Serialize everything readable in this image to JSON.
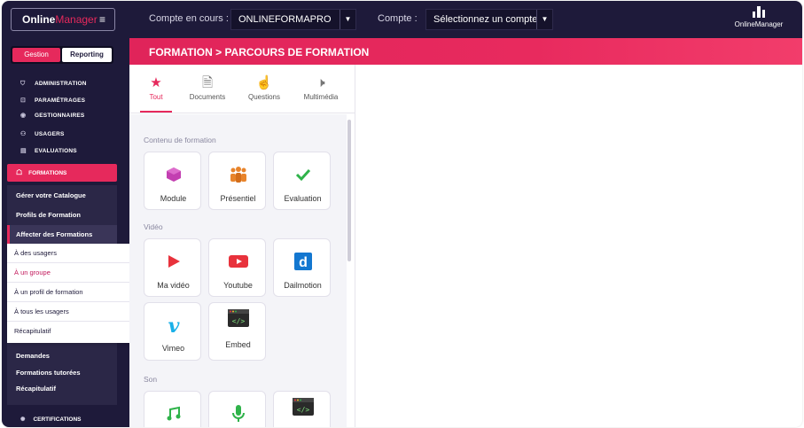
{
  "topbar": {
    "brand_main": "Online",
    "brand_accent": "Manager",
    "menu_glyph": "≡",
    "compte_en_cours_label": "Compte en cours :",
    "compte_en_cours_value": "ONLINEFORMAPRO",
    "compte_label": "Compte :",
    "compte_placeholder": "Sélectionnez un compte",
    "logo_text": "OnlineManager"
  },
  "sidebar": {
    "tab_gestion": "Gestion",
    "tab_reporting": "Reporting",
    "items": [
      {
        "icon": "shield-icon",
        "label": "ADMINISTRATION"
      },
      {
        "icon": "settings-icon",
        "label": "PARAMÉTRAGES"
      },
      {
        "icon": "user-circle-icon",
        "label": "GESTIONNAIRES"
      },
      {
        "icon": "users-icon",
        "label": "USAGERS"
      },
      {
        "icon": "clipboard-icon",
        "label": "EVALUATIONS"
      }
    ],
    "formations_label": "FORMATIONS",
    "sub_items": [
      "Gérer votre Catalogue",
      "Profils de Formation",
      "Affecter des Formations",
      "Demandes",
      "Formations tutorées",
      "Récapitulatif"
    ],
    "dropdown_items": [
      "À des usagers",
      "À un groupe",
      "À un profil de formation",
      "À tous les usagers",
      "Récapitulatif"
    ],
    "certifications_label": "CERTIFICATIONS"
  },
  "header": {
    "breadcrumb": "FORMATION > PARCOURS DE FORMATION"
  },
  "library": {
    "tabs": [
      {
        "icon": "star-icon",
        "label": "Tout",
        "active": true
      },
      {
        "icon": "document-icon",
        "label": "Documents",
        "active": false
      },
      {
        "icon": "pointer-hand-icon",
        "label": "Questions",
        "active": false
      },
      {
        "icon": "speaker-icon",
        "label": "Multimédia",
        "active": false
      }
    ],
    "sections": [
      {
        "title": "Contenu de formation",
        "cards": [
          {
            "icon": "cube-icon",
            "label": "Module"
          },
          {
            "icon": "people-icon",
            "label": "Présentiel"
          },
          {
            "icon": "checkmark-icon",
            "label": "Evaluation"
          }
        ]
      },
      {
        "title": "Vidéo",
        "cards": [
          {
            "icon": "play-icon",
            "label": "Ma vidéo"
          },
          {
            "icon": "youtube-icon",
            "label": "Youtube"
          },
          {
            "icon": "dailymotion-icon",
            "label": "Dailmotion"
          },
          {
            "icon": "vimeo-icon",
            "label": "Vimeo"
          },
          {
            "icon": "embed-icon",
            "label": "Embed"
          }
        ]
      },
      {
        "title": "Son",
        "cards": [
          {
            "icon": "music-note-icon",
            "label": ""
          },
          {
            "icon": "microphone-icon",
            "label": ""
          },
          {
            "icon": "embed-icon",
            "label": ""
          }
        ]
      }
    ]
  },
  "colors": {
    "navy": "#1e1a3a",
    "accent": "#e6295c",
    "module_purple": "#c33fb1",
    "presentiel_orange": "#e8842b",
    "evaluation_green": "#2fb34a",
    "video_red": "#e8323c",
    "dailymotion_blue": "#1377d0",
    "vimeo_blue": "#1ab0e8",
    "sound_green": "#2fb34a"
  }
}
